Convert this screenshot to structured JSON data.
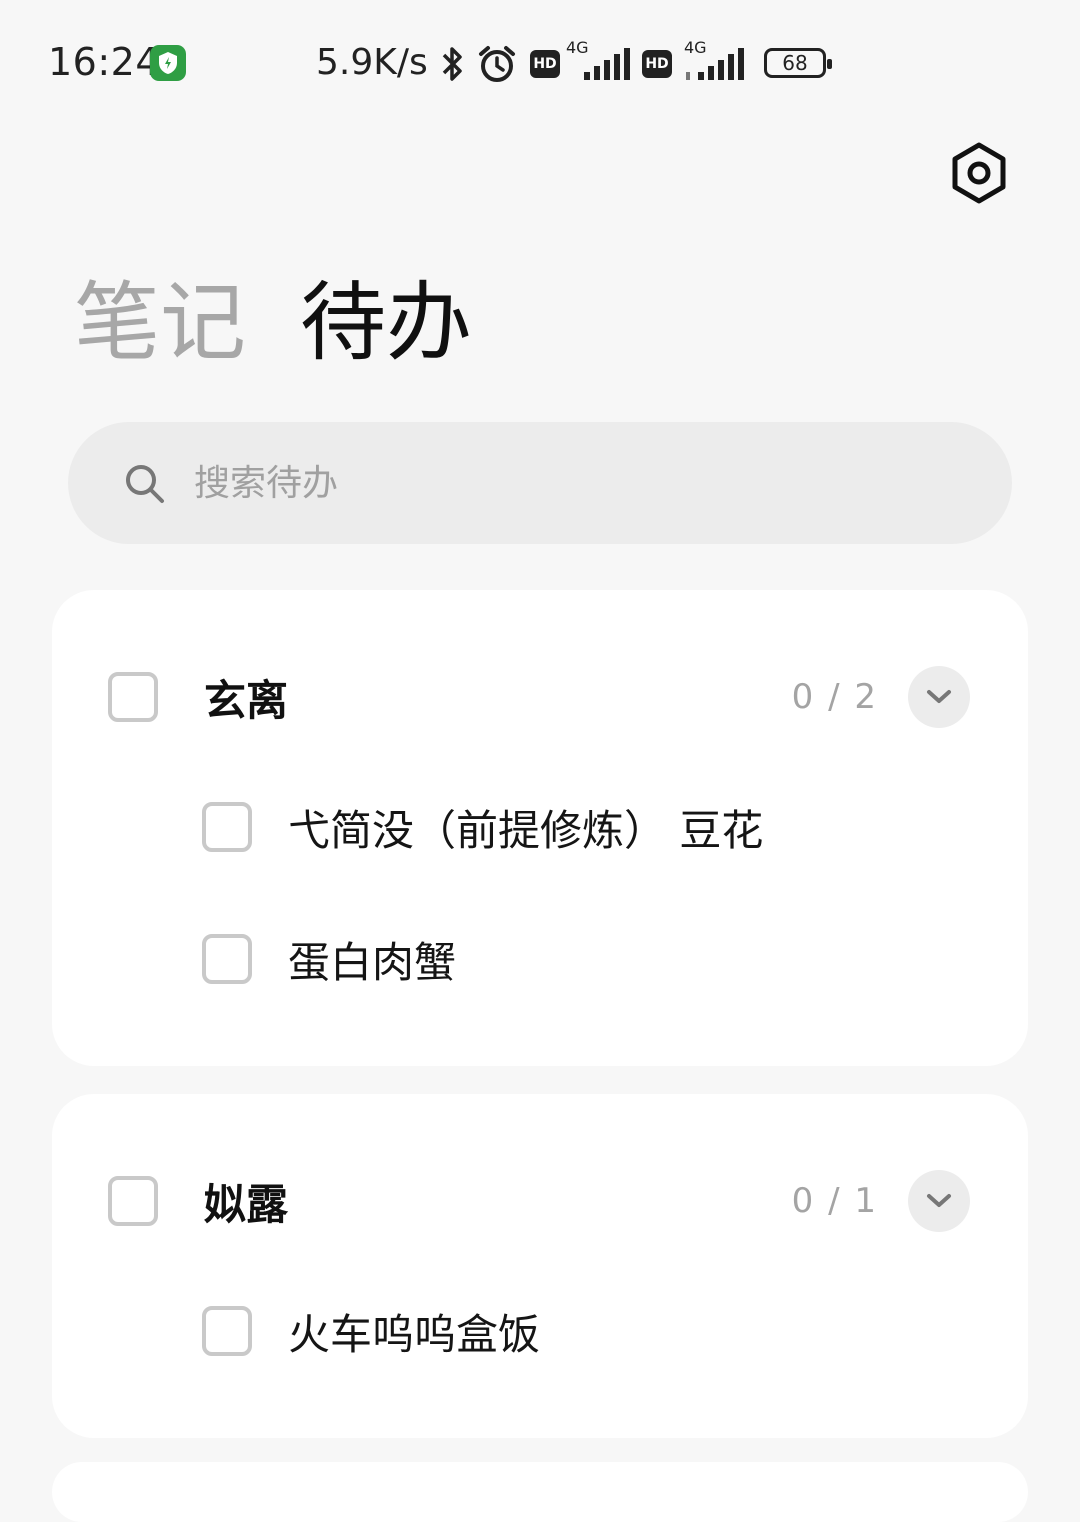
{
  "status_bar": {
    "time": "16:24",
    "net_speed": "5.9K/s",
    "sim1_type": "4G",
    "sim2_type": "4G",
    "hd_label": "HD",
    "battery": "68",
    "icons": [
      "app-shield-icon",
      "bluetooth-icon",
      "alarm-icon",
      "hd-icon",
      "signal-icon",
      "battery-icon"
    ]
  },
  "header": {
    "tabs": [
      {
        "label": "笔记",
        "active": false
      },
      {
        "label": "待办",
        "active": true
      }
    ],
    "settings_icon": "settings-hexagon-icon"
  },
  "search": {
    "placeholder": "搜索待办",
    "value": ""
  },
  "groups": [
    {
      "title": "玄离",
      "count": "0 / 2",
      "checked": false,
      "items": [
        {
          "label": "弋简没（前提修炼） 豆花",
          "checked": false
        },
        {
          "label": "蛋白肉蟹",
          "checked": false
        }
      ]
    },
    {
      "title": "姒露",
      "count": "0 / 1",
      "checked": false,
      "items": [
        {
          "label": "火车呜呜盒饭",
          "checked": false
        }
      ]
    }
  ],
  "colors": {
    "background": "#f7f7f7",
    "card": "#ffffff",
    "search_bg": "#ececec",
    "inactive_tab": "#a7a7a7",
    "checkbox_border": "#c9c9c9"
  }
}
